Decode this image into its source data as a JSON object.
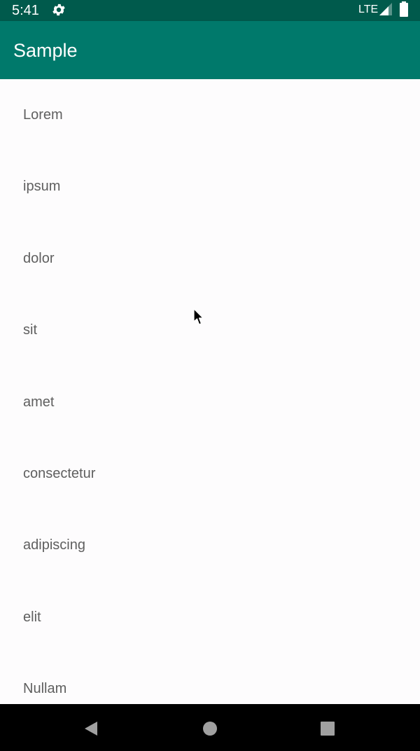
{
  "status_bar": {
    "time": "5:41",
    "network": "LTE",
    "icons": [
      "gear-icon",
      "signal-icon",
      "battery-icon"
    ]
  },
  "app_bar": {
    "title": "Sample"
  },
  "list": {
    "items": [
      {
        "label": "Lorem"
      },
      {
        "label": "ipsum"
      },
      {
        "label": "dolor"
      },
      {
        "label": "sit"
      },
      {
        "label": "amet"
      },
      {
        "label": "consectetur"
      },
      {
        "label": "adipiscing"
      },
      {
        "label": "elit"
      },
      {
        "label": "Nullam"
      }
    ]
  },
  "nav_bar": {
    "icons": [
      "back-icon",
      "home-icon",
      "recents-icon"
    ]
  },
  "colors": {
    "status_bar": "#005a4c",
    "app_bar": "#00796b",
    "background": "#fdfcfd",
    "list_text": "#5f5f5f",
    "nav_bar": "#000000"
  }
}
